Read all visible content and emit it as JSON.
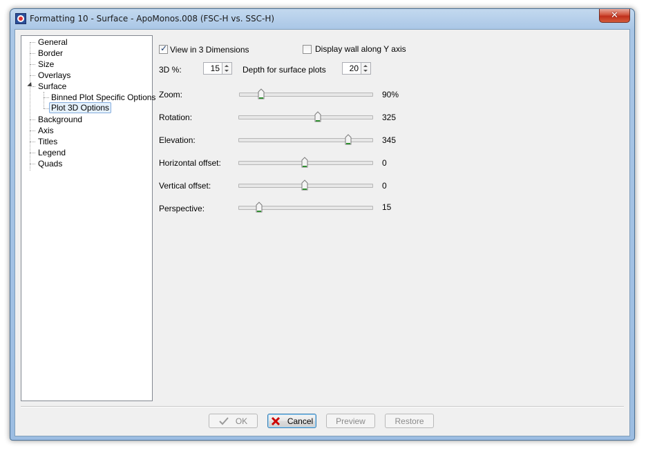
{
  "window": {
    "title": "Formatting 10 - Surface - ApoMonos.008 (FSC-H vs. SSC-H)",
    "close_glyph": "✕"
  },
  "tree": {
    "items": [
      {
        "label": "General"
      },
      {
        "label": "Border"
      },
      {
        "label": "Size"
      },
      {
        "label": "Overlays"
      },
      {
        "label": "Surface",
        "expanded": true
      },
      {
        "label": "Binned Plot Specific Options"
      },
      {
        "label": "Plot 3D Options",
        "selected": true
      },
      {
        "label": "Background"
      },
      {
        "label": "Axis"
      },
      {
        "label": "Titles"
      },
      {
        "label": "Legend"
      },
      {
        "label": "Quads"
      }
    ]
  },
  "options": {
    "view3d": {
      "label": "View in 3 Dimensions",
      "checked": true
    },
    "wall_y": {
      "label": "Display wall along Y axis",
      "checked": false
    },
    "pct3d": {
      "label": "3D %:",
      "value": "15"
    },
    "depth": {
      "label": "Depth for surface plots",
      "value": "20"
    }
  },
  "sliders": [
    {
      "label": "Zoom:",
      "value": "90%",
      "level": 0.17
    },
    {
      "label": "Rotation:",
      "value": "325",
      "level": 0.6
    },
    {
      "label": "Elevation:",
      "value": "345",
      "level": 0.83
    },
    {
      "label": "Horizontal offset:",
      "value": "0",
      "level": 0.5
    },
    {
      "label": "Vertical offset:",
      "value": "0",
      "level": 0.5
    },
    {
      "label": "Perspective:",
      "value": "15",
      "level": 0.15
    }
  ],
  "buttons": {
    "ok": "OK",
    "cancel": "Cancel",
    "preview": "Preview",
    "restore": "Restore"
  },
  "colors": {
    "accent": "#3c7fb1",
    "cancel_icon": "#cc0000",
    "slider_thumb": "#2f8f2f"
  }
}
